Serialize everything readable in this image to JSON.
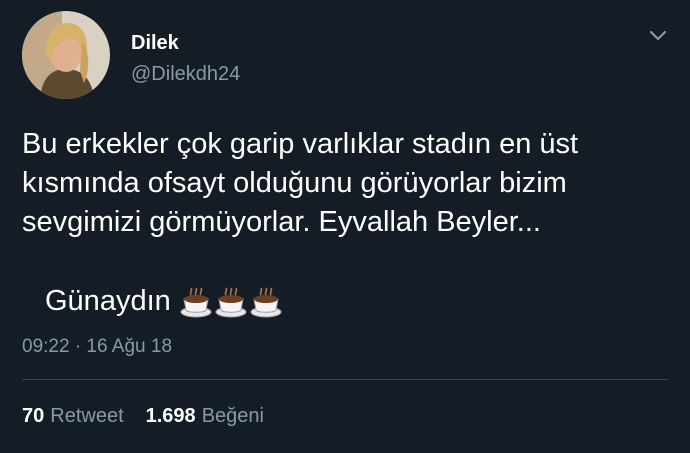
{
  "author": {
    "name": "Dilek",
    "handle": "@Dilekdh24"
  },
  "tweet": {
    "text": "Bu erkekler çok garip varlıklar stadın en üst kısmında ofsayt olduğunu görüyorlar bizim sevgimizi görmüyorlar. Eyvallah Beyler...",
    "greeting": "Günaydın",
    "emoji_icons": [
      "hot-beverage-icon",
      "hot-beverage-icon",
      "hot-beverage-icon"
    ],
    "timestamp": "09:22 · 16 Ağu 18"
  },
  "stats": {
    "retweet_count": "70",
    "retweet_label": "Retweet",
    "like_count": "1.698",
    "like_label": "Beğeni"
  },
  "colors": {
    "background": "#141d26",
    "secondary_text": "#8899a6",
    "divider": "#38444d"
  }
}
